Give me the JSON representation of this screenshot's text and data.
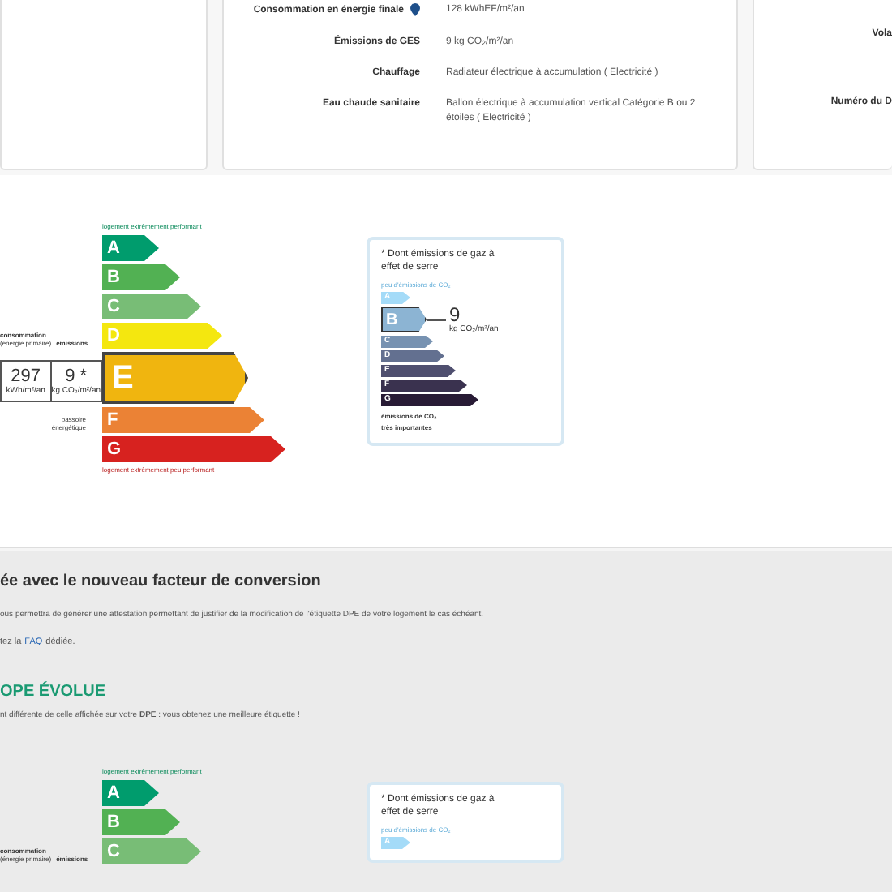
{
  "energy_card": {
    "rows": [
      {
        "label": "Consommation en énergie finale",
        "info": true,
        "value": "128 kWhEF/m²/an"
      },
      {
        "label": "Émissions de GES",
        "info": false,
        "value": "9 kg CO$_{2}$/m²/an"
      },
      {
        "label": "Chauffage",
        "info": false,
        "value": "Radiateur électrique à accumulation ( Electricité )"
      },
      {
        "label": "Eau chaude sanitaire",
        "info": false,
        "value": "Ballon électrique à accumulation vertical Catégorie B ou 2 étoiles ( Electricité )"
      }
    ]
  },
  "side_card": {
    "labels": [
      "Vola",
      "Numéro du D"
    ]
  },
  "energy_label": {
    "top_caption": "logement extrêmement performant",
    "bottom_caption": "logement extrêmement peu performant",
    "consumption_caption": "consommation",
    "consumption_sub": "(énergie primaire)",
    "emissions_caption": "émissions",
    "consumption_value": "297",
    "consumption_unit": "kWh/m²/an",
    "emissions_value": "9 *",
    "emissions_unit": "kg CO₂/m²/an",
    "side_note": "passoire énergétique",
    "classes": [
      {
        "letter": "A",
        "color": "#009c6d",
        "selected": false
      },
      {
        "letter": "B",
        "color": "#52b153",
        "selected": false
      },
      {
        "letter": "C",
        "color": "#78bd76",
        "selected": false
      },
      {
        "letter": "D",
        "color": "#f4e70f",
        "selected": false
      },
      {
        "letter": "E",
        "color": "#f0b50f",
        "selected": true
      },
      {
        "letter": "F",
        "color": "#eb8235",
        "selected": false
      },
      {
        "letter": "G",
        "color": "#d7221f",
        "selected": false
      }
    ]
  },
  "ges_box": {
    "title": "* Dont émissions de gaz à effet de serre",
    "top_caption": "peu d'émissions de CO₂",
    "value": "9",
    "unit": "kg CO₂/m²/an",
    "bottom_caption": "émissions de CO₂",
    "bottom_caption_2": "très importantes",
    "classes": [
      {
        "letter": "A",
        "color": "#a4dbf8",
        "selected": false
      },
      {
        "letter": "B",
        "color": "#8cb4d3",
        "selected": true
      },
      {
        "letter": "C",
        "color": "#7792b1",
        "selected": false
      },
      {
        "letter": "D",
        "color": "#637090",
        "selected": false
      },
      {
        "letter": "E",
        "color": "#4f4f6f",
        "selected": false
      },
      {
        "letter": "F",
        "color": "#3a324f",
        "selected": false
      },
      {
        "letter": "G",
        "color": "#281b35",
        "selected": false
      }
    ]
  },
  "notice": {
    "heading": "ée avec le nouveau facteur de conversion",
    "paragraph": "ous permettra de générer une attestation permettant de justifier de la modification de l'étiquette DPE de votre logement le cas échéant.",
    "faq_before": "tez la",
    "faq_link": "FAQ",
    "faq_after": "dédiée."
  },
  "evolution": {
    "heading": "OPE ÉVOLUE",
    "text": "nt différente de celle affichée sur votre **DPE** : vous obtenez une meilleure étiquette !",
    "energy_label": {
      "top_caption": "logement extrêmement performant",
      "consumption_caption": "consommation",
      "consumption_sub": "(énergie primaire)",
      "emissions_caption": "émissions",
      "classes": [
        {
          "letter": "A",
          "color": "#009c6d",
          "selected": false
        },
        {
          "letter": "B",
          "color": "#52b153",
          "selected": false
        },
        {
          "letter": "C",
          "color": "#78bd76",
          "selected": false
        }
      ]
    },
    "ges_box": {
      "title": "* Dont émissions de gaz à effet de serre",
      "top_caption": "peu d'émissions de CO₂",
      "classes": [
        {
          "letter": "A",
          "color": "#a4dbf8",
          "selected": false
        }
      ]
    }
  }
}
